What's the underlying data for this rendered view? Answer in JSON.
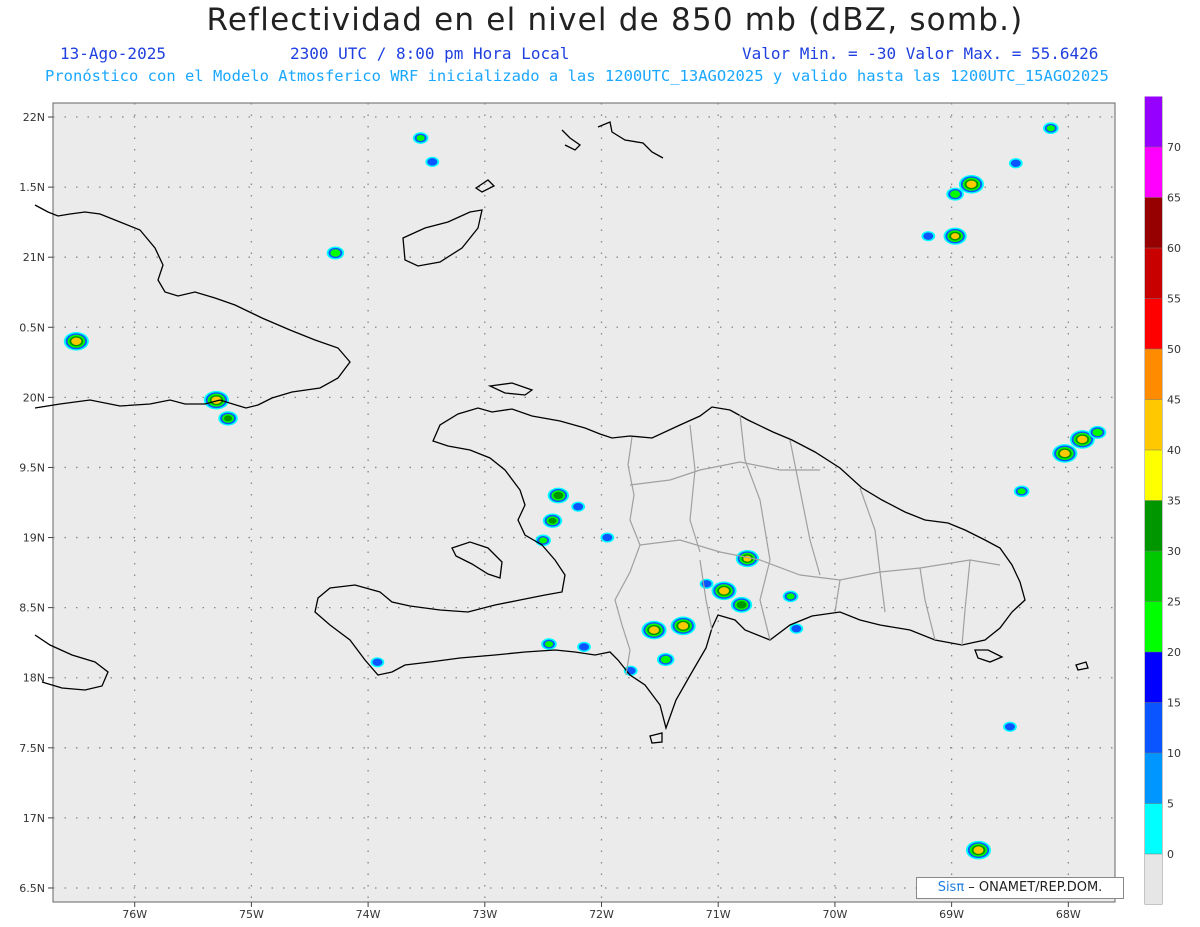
{
  "header": {
    "title": "Reflectividad en el nivel de 850 mb (dBZ, somb.)",
    "date": "13-Ago-2025",
    "time": "2300 UTC / 8:00 pm Hora Local",
    "range": "Valor Min. = -30  Valor Max. = 55.6426",
    "forecast": "Pronóstico con el Modelo Atmosferico WRF inicializado a las 1200UTC_13AGO2025 y valido hasta las  1200UTC_15AGO2025"
  },
  "map": {
    "lon_range": [
      -76.7,
      -67.6
    ],
    "lat_range": [
      16.4,
      22.1
    ],
    "lat_ticks": [
      {
        "value": 22.0,
        "label": "22N"
      },
      {
        "value": 21.5,
        "label": "1.5N"
      },
      {
        "value": 21.0,
        "label": "21N"
      },
      {
        "value": 20.5,
        "label": "0.5N"
      },
      {
        "value": 20.0,
        "label": "20N"
      },
      {
        "value": 19.5,
        "label": "9.5N"
      },
      {
        "value": 19.0,
        "label": "19N"
      },
      {
        "value": 18.5,
        "label": "8.5N"
      },
      {
        "value": 18.0,
        "label": "18N"
      },
      {
        "value": 17.5,
        "label": "7.5N"
      },
      {
        "value": 17.0,
        "label": "17N"
      },
      {
        "value": 16.5,
        "label": "6.5N"
      }
    ],
    "lon_ticks": [
      {
        "value": -76,
        "label": "76W"
      },
      {
        "value": -75,
        "label": "75W"
      },
      {
        "value": -74,
        "label": "74W"
      },
      {
        "value": -73,
        "label": "73W"
      },
      {
        "value": -72,
        "label": "72W"
      },
      {
        "value": -71,
        "label": "71W"
      },
      {
        "value": -70,
        "label": "70W"
      },
      {
        "value": -69,
        "label": "69W"
      },
      {
        "value": -68,
        "label": "68W"
      }
    ],
    "background_color": "#ebebeb",
    "coast_color": "#000000",
    "border_color": "#a0a0a0"
  },
  "colorbar": {
    "levels": [
      0,
      5,
      10,
      15,
      20,
      25,
      30,
      35,
      40,
      45,
      50,
      55,
      60,
      65,
      70
    ],
    "colors": [
      "#00ffff",
      "#0096ff",
      "#0a55ff",
      "#0000ff",
      "#00ff00",
      "#00c800",
      "#009600",
      "#ffff00",
      "#ffc800",
      "#ff8c00",
      "#ff0000",
      "#c80000",
      "#960000",
      "#ff00ff",
      "#9600ff"
    ]
  },
  "storms": [
    {
      "lon": -76.5,
      "lat": 20.4,
      "max": 45
    },
    {
      "lon": -75.3,
      "lat": 19.98,
      "max": 45
    },
    {
      "lon": -75.2,
      "lat": 19.85,
      "max": 30
    },
    {
      "lon": -74.28,
      "lat": 21.03,
      "max": 25
    },
    {
      "lon": -73.55,
      "lat": 21.85,
      "max": 20
    },
    {
      "lon": -73.45,
      "lat": 21.68,
      "max": 15
    },
    {
      "lon": -72.37,
      "lat": 19.3,
      "max": 35
    },
    {
      "lon": -72.42,
      "lat": 19.12,
      "max": 30
    },
    {
      "lon": -72.5,
      "lat": 18.98,
      "max": 20
    },
    {
      "lon": -72.2,
      "lat": 19.22,
      "max": 15
    },
    {
      "lon": -71.95,
      "lat": 19.0,
      "max": 15
    },
    {
      "lon": -71.55,
      "lat": 18.34,
      "max": 45
    },
    {
      "lon": -71.3,
      "lat": 18.37,
      "max": 45
    },
    {
      "lon": -71.45,
      "lat": 18.13,
      "max": 25
    },
    {
      "lon": -71.75,
      "lat": 18.05,
      "max": 15
    },
    {
      "lon": -72.45,
      "lat": 18.24,
      "max": 20
    },
    {
      "lon": -72.15,
      "lat": 18.22,
      "max": 15
    },
    {
      "lon": -70.75,
      "lat": 18.85,
      "max": 40
    },
    {
      "lon": -70.95,
      "lat": 18.62,
      "max": 45
    },
    {
      "lon": -70.8,
      "lat": 18.52,
      "max": 35
    },
    {
      "lon": -70.38,
      "lat": 18.58,
      "max": 20
    },
    {
      "lon": -70.33,
      "lat": 18.35,
      "max": 15
    },
    {
      "lon": -71.1,
      "lat": 18.67,
      "max": 15
    },
    {
      "lon": -68.97,
      "lat": 21.15,
      "max": 40
    },
    {
      "lon": -68.83,
      "lat": 21.52,
      "max": 45
    },
    {
      "lon": -68.97,
      "lat": 21.45,
      "max": 25
    },
    {
      "lon": -68.15,
      "lat": 21.92,
      "max": 20
    },
    {
      "lon": -68.45,
      "lat": 21.67,
      "max": 15
    },
    {
      "lon": -69.2,
      "lat": 21.15,
      "max": 15
    },
    {
      "lon": -68.03,
      "lat": 19.6,
      "max": 45
    },
    {
      "lon": -67.88,
      "lat": 19.7,
      "max": 45
    },
    {
      "lon": -67.75,
      "lat": 19.75,
      "max": 25
    },
    {
      "lon": -68.4,
      "lat": 19.33,
      "max": 20
    },
    {
      "lon": -68.5,
      "lat": 17.65,
      "max": 15
    },
    {
      "lon": -68.77,
      "lat": 16.77,
      "max": 45
    },
    {
      "lon": -73.92,
      "lat": 18.11,
      "max": 15
    }
  ],
  "credit": {
    "logo": "Sis",
    "logo_sym": "π",
    "text": " – ONAMET/REP.DOM."
  }
}
